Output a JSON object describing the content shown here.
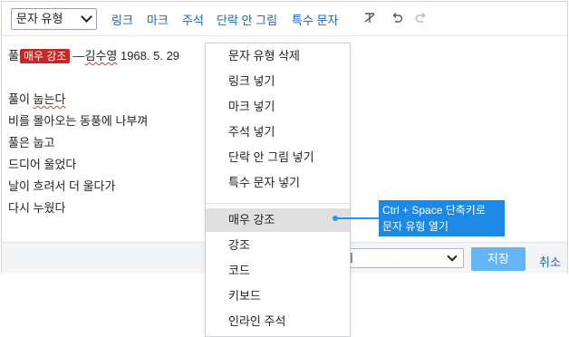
{
  "toolbar": {
    "style_select_value": "문자 유형",
    "links": [
      "링크",
      "마크",
      "주석",
      "단락 안 그림",
      "특수 문자"
    ],
    "icons": [
      "clear-format-icon",
      "undo-icon",
      "redo-icon"
    ]
  },
  "content": {
    "line1": {
      "prefix": "풀",
      "badge": "매우 강조",
      "dash": "—",
      "author": "김수영",
      "date": " 1968. 5. 29"
    },
    "line3": {
      "part1": "풀이 ",
      "part2": "눕는다"
    },
    "line4": "비를 몰아오는 동풍에 나부껴",
    "line5": "풀은 눕고",
    "line6": "드디어 울었다",
    "line7": "날이 흐려서 더 울다가",
    "line8": "다시 누웠다"
  },
  "footer": {
    "select_value": "지",
    "save_label": "저장",
    "cancel_label": "취소"
  },
  "menu": {
    "items": [
      "문자 유형 삭제",
      "링크 넣기",
      "마크 넣기",
      "주석 넣기",
      "단락 안 그림 넣기",
      "특수 문자 넣기",
      "매우 강조",
      "강조",
      "코드",
      "키보드",
      "인라인 주석"
    ],
    "selected": "매우 강조"
  },
  "tooltip": {
    "line1": "Ctrl + Space 단축키로",
    "line2": "문자 유형 열기"
  },
  "colors": {
    "link": "#1565c0",
    "badge": "#c62828",
    "accent": "#2196f3",
    "save_button": "#64b5f6",
    "menu_selected": "#e0e0e0"
  }
}
